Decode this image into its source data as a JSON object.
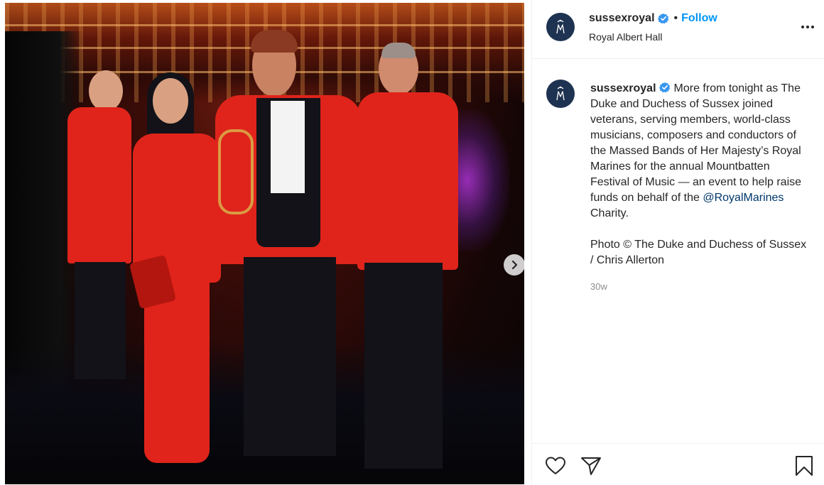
{
  "post": {
    "photo_alt": "",
    "next_icon": "chevron-right-icon"
  },
  "header": {
    "username": "sussexroyal",
    "separator": "•",
    "follow_label": "Follow",
    "location": "Royal Albert Hall",
    "more_icon": "more-options-icon"
  },
  "caption": {
    "username": "sussexroyal",
    "text": "More from tonight as The Duke and Duchess of Sussex joined veterans, serving members, world-class musicians, composers and conductors of the Massed Bands of Her Majesty’s Royal Marines for the annual Mountbatten Festival of Music — an event to help raise funds on behalf of the",
    "mention": "@RoyalMarines",
    "text_after": " Charity.",
    "credit": "Photo © The Duke and Duchess of Sussex / Chris Allerton",
    "timestamp": "30w"
  },
  "actions": {
    "like_icon": "heart-icon",
    "share_icon": "send-icon",
    "save_icon": "bookmark-icon"
  },
  "colors": {
    "accent": "#0095f6",
    "mention": "#00376b",
    "text": "#262626",
    "muted": "#8e8e8e",
    "avatar_bg": "#1e3251"
  }
}
